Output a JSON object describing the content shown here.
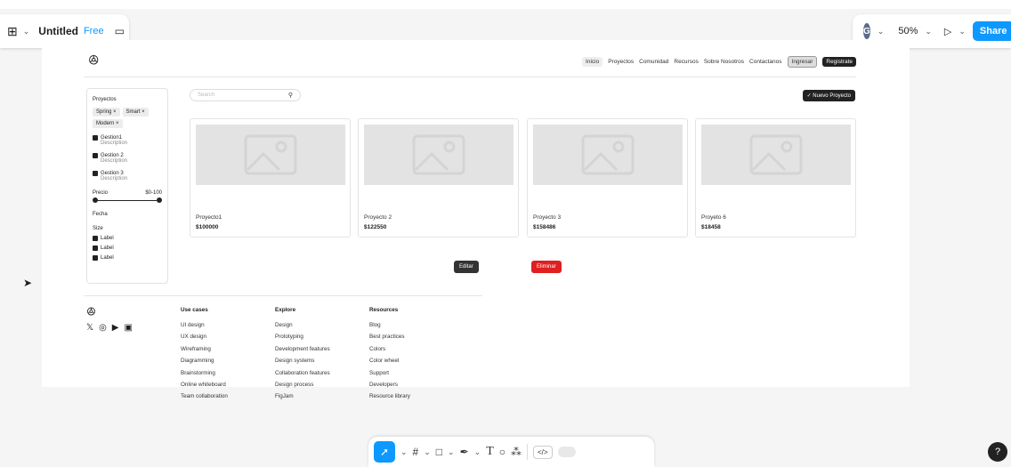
{
  "header": {
    "grid_icon": "#",
    "file_title": "Untitled",
    "plan_badge": "Free",
    "avatar_initial": "G",
    "zoom": "50%",
    "share_label": "Share"
  },
  "site": {
    "nav": [
      "Inicio",
      "Proyectos",
      "Comunidad",
      "Recursos",
      "Sobre Nosotros",
      "Contactanos"
    ],
    "login": "Ingresar",
    "register": "Registrate",
    "search_placeholder": "Search",
    "new_project": "✓ Nuevo Proyecto",
    "filter": {
      "title": "Proyectos",
      "chips": [
        "Spring ×",
        "Smart ×",
        "Modern ×"
      ],
      "items": [
        {
          "label": "Gestion1",
          "desc": "Description"
        },
        {
          "label": "Gestion 2",
          "desc": "Description"
        },
        {
          "label": "Gestion 3",
          "desc": "Description"
        }
      ],
      "price_label": "Precio",
      "price_range": "$0-100",
      "date_label": "Fecha",
      "size_label": "Size",
      "size_options": [
        "Label",
        "Label",
        "Label"
      ]
    },
    "cards": [
      {
        "name": "Proyecto1",
        "price": "$100000"
      },
      {
        "name": "Proyecto 2",
        "price": "$122550"
      },
      {
        "name": "Proyecto 3",
        "price": "$158486"
      },
      {
        "name": "Proyeto 6",
        "price": "$18458"
      }
    ],
    "edit_label": "Editar",
    "delete_label": "Eliminar",
    "footer": {
      "columns": [
        {
          "heading": "Use cases",
          "items": [
            "UI design",
            "UX design",
            "Wireframing",
            "Diagramming",
            "Brainstorming",
            "Online whiteboard",
            "Team collaboration"
          ]
        },
        {
          "heading": "Explore",
          "items": [
            "Design",
            "Prototyping",
            "Development features",
            "Design systems",
            "Collaboration features",
            "Design process",
            "FigJam"
          ]
        },
        {
          "heading": "Resources",
          "items": [
            "Blog",
            "Best practices",
            "Colors",
            "Color wheel",
            "Support",
            "Developers",
            "Resource library"
          ]
        }
      ]
    }
  },
  "colors": {
    "accent": "#0d99ff",
    "danger": "#e02020",
    "dark": "#222222"
  }
}
